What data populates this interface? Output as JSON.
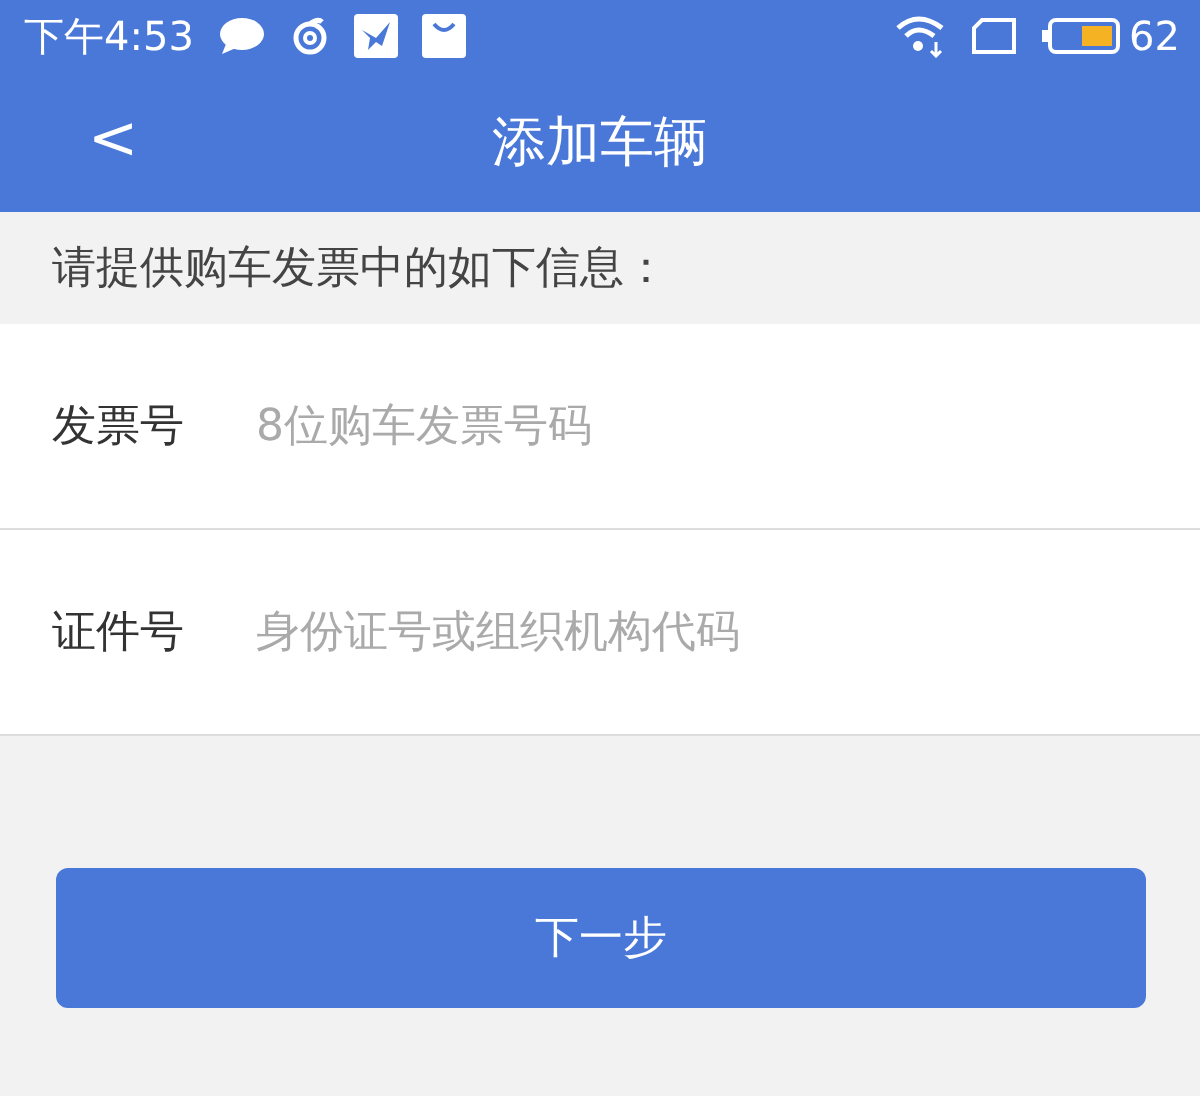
{
  "status_bar": {
    "time": "下午4:53",
    "battery": "62"
  },
  "header": {
    "back": "<",
    "title": "添加车辆"
  },
  "hint": "请提供购车发票中的如下信息：",
  "fields": [
    {
      "label": "发票号",
      "placeholder": "8位购车发票号码"
    },
    {
      "label": "证件号",
      "placeholder": "身份证号或组织机构代码"
    }
  ],
  "button": "下一步"
}
